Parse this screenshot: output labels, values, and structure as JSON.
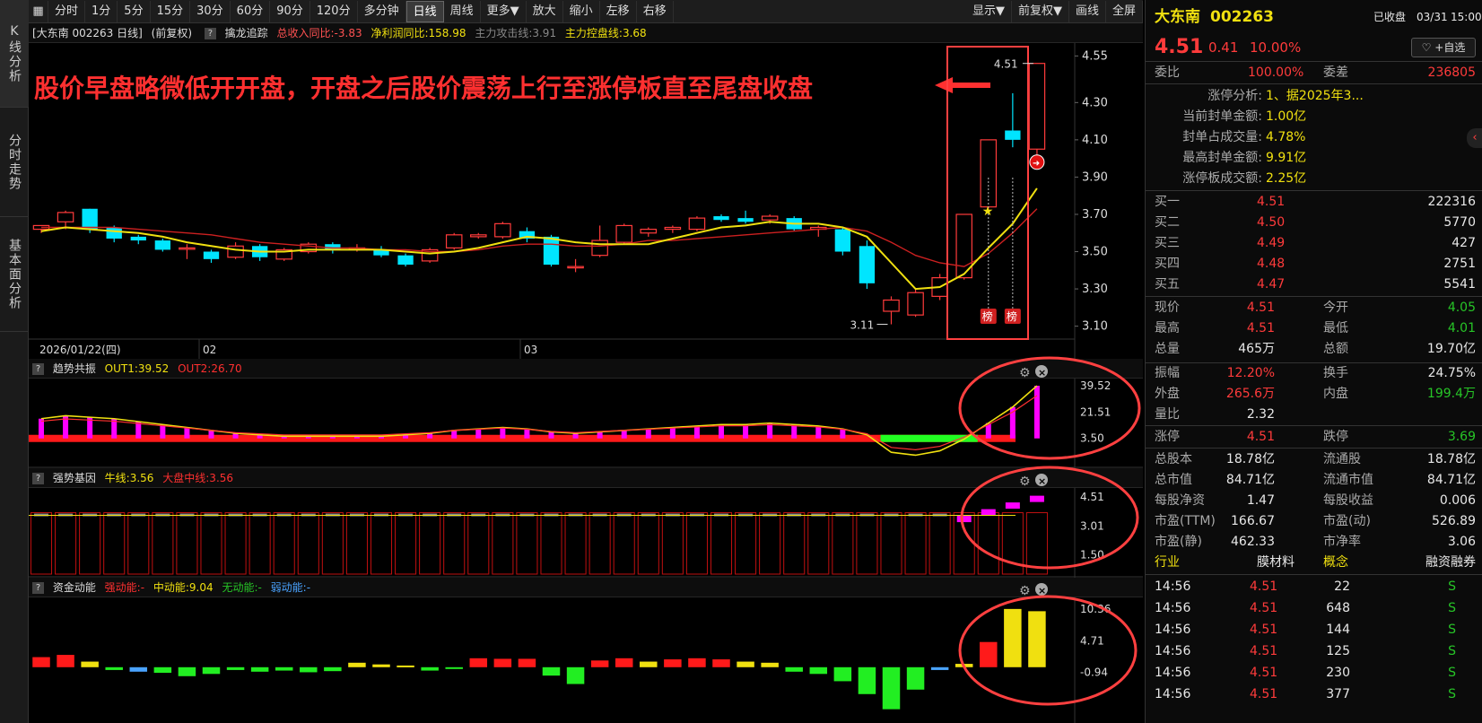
{
  "left_tabs": [
    "K线分析",
    "分时走势",
    "基本面分析"
  ],
  "toolbar": {
    "items": [
      "分时",
      "1分",
      "5分",
      "15分",
      "30分",
      "60分",
      "90分",
      "120分",
      "多分钟",
      "日线",
      "周线",
      "更多▼",
      "放大",
      "缩小",
      "左移",
      "右移"
    ],
    "active": "日线",
    "right_items": [
      "显示▼",
      "前复权▼",
      "画线",
      "全屏"
    ]
  },
  "main_header": {
    "stock": "[大东南 002263 日线]",
    "adj": "(前复权)",
    "indicator": "擒龙追踪",
    "rev_yoy": "总收入同比:-3.83",
    "profit_yoy": "净利润同比:158.98",
    "attack_line": "主力攻击线:3.91",
    "control_line": "主力控盘线:3.68"
  },
  "annotation": "股价早盘略微低开开盘，开盘之后股价震荡上行至涨停板直至尾盘收盘",
  "price_axis": [
    "4.55",
    "4.30",
    "4.10",
    "3.90",
    "3.70",
    "3.50",
    "3.30",
    "3.10"
  ],
  "price_labels": {
    "high": "4.51",
    "low": "3.11"
  },
  "bang_label": "榜",
  "date_axis": {
    "start": "2026/01/22(四)",
    "m2": "02",
    "m3": "03"
  },
  "panel1": {
    "name": "趋势共振",
    "out1": "OUT1:39.52",
    "out2": "OUT2:26.70",
    "axis": [
      "39.52",
      "21.51",
      "3.50"
    ]
  },
  "panel2": {
    "name": "强势基因",
    "bull": "牛线:3.56",
    "mid": "大盘中线:3.56",
    "axis": [
      "4.51",
      "3.01",
      "1.50"
    ]
  },
  "panel3": {
    "name": "资金动能",
    "strong": "强动能:-",
    "medium": "中动能:9.04",
    "none": "无动能:-",
    "weak": "弱动能:-",
    "axis": [
      "10.36",
      "4.71",
      "-0.94"
    ]
  },
  "right": {
    "name": "大东南",
    "code": "002263",
    "status": "已收盘",
    "date": "03/31",
    "time": "15:00",
    "price": "4.51",
    "change": "0.41",
    "pct": "10.00%",
    "watch": "+自选",
    "wei_bi_label": "委比",
    "wei_bi": "100.00%",
    "wei_cha_label": "委差",
    "wei_cha": "236805",
    "limit_analysis": [
      {
        "label": "涨停分析:",
        "value": "1、据2025年3..."
      },
      {
        "label": "当前封单金额:",
        "value": "1.00亿"
      },
      {
        "label": "封单占成交量:",
        "value": "4.78%"
      },
      {
        "label": "最高封单金额:",
        "value": "9.91亿"
      },
      {
        "label": "涨停板成交额:",
        "value": "2.25亿"
      }
    ],
    "bids": [
      {
        "label": "买一",
        "price": "4.51",
        "vol": "222316"
      },
      {
        "label": "买二",
        "price": "4.50",
        "vol": "5770"
      },
      {
        "label": "买三",
        "price": "4.49",
        "vol": "427"
      },
      {
        "label": "买四",
        "price": "4.48",
        "vol": "2751"
      },
      {
        "label": "买五",
        "price": "4.47",
        "vol": "5541"
      }
    ],
    "stats": [
      {
        "l1": "现价",
        "v1": "4.51",
        "c1": "red",
        "l2": "今开",
        "v2": "4.05",
        "c2": "green"
      },
      {
        "l1": "最高",
        "v1": "4.51",
        "c1": "red",
        "l2": "最低",
        "v2": "4.01",
        "c2": "green"
      },
      {
        "l1": "总量",
        "v1": "465万",
        "c1": "white",
        "l2": "总额",
        "v2": "19.70亿",
        "c2": "white"
      }
    ],
    "stats2": [
      {
        "l1": "振幅",
        "v1": "12.20%",
        "c1": "red",
        "l2": "换手",
        "v2": "24.75%",
        "c2": "white"
      },
      {
        "l1": "外盘",
        "v1": "265.6万",
        "c1": "red",
        "l2": "内盘",
        "v2": "199.4万",
        "c2": "green"
      },
      {
        "l1": "量比",
        "v1": "2.32",
        "c1": "white",
        "l2": "",
        "v2": "",
        "c2": "white"
      }
    ],
    "limits": {
      "l1": "涨停",
      "v1": "4.51",
      "l2": "跌停",
      "v2": "3.69"
    },
    "fund": [
      {
        "l1": "总股本",
        "v1": "18.78亿",
        "l2": "流通股",
        "v2": "18.78亿"
      },
      {
        "l1": "总市值",
        "v1": "84.71亿",
        "l2": "流通市值",
        "v2": "84.71亿"
      },
      {
        "l1": "每股净资",
        "v1": "1.47",
        "l2": "每股收益",
        "v2": "0.006"
      },
      {
        "l1": "市盈(TTM)",
        "v1": "166.67",
        "l2": "市盈(动)",
        "v2": "526.89"
      },
      {
        "l1": "市盈(静)",
        "v1": "462.33",
        "l2": "市净率",
        "v2": "3.06"
      }
    ],
    "industry": {
      "l1": "行业",
      "v1": "膜材料",
      "l2": "概念",
      "v2": "融资融券"
    },
    "ticks": [
      {
        "time": "14:56",
        "price": "4.51",
        "vol": "22",
        "side": "S"
      },
      {
        "time": "14:56",
        "price": "4.51",
        "vol": "648",
        "side": "S"
      },
      {
        "time": "14:56",
        "price": "4.51",
        "vol": "144",
        "side": "S"
      },
      {
        "time": "14:56",
        "price": "4.51",
        "vol": "125",
        "side": "S"
      },
      {
        "time": "14:56",
        "price": "4.51",
        "vol": "230",
        "side": "S"
      },
      {
        "time": "14:56",
        "price": "4.51",
        "vol": "377",
        "side": "S"
      }
    ]
  },
  "colors": {
    "up": "#ff3b3b",
    "down": "#00e5ff",
    "ma5": "#f0e010",
    "ma10": "#cc2020",
    "annotation": "#ff3030",
    "magenta": "#ff00ff"
  },
  "candles": [
    [
      3.62,
      3.64,
      3.6,
      3.64
    ],
    [
      3.66,
      3.72,
      3.62,
      3.71
    ],
    [
      3.73,
      3.73,
      3.6,
      3.62
    ],
    [
      3.63,
      3.64,
      3.55,
      3.57
    ],
    [
      3.58,
      3.59,
      3.54,
      3.56
    ],
    [
      3.56,
      3.57,
      3.5,
      3.51
    ],
    [
      3.52,
      3.54,
      3.46,
      3.52
    ],
    [
      3.5,
      3.51,
      3.44,
      3.46
    ],
    [
      3.47,
      3.55,
      3.46,
      3.53
    ],
    [
      3.53,
      3.54,
      3.45,
      3.47
    ],
    [
      3.46,
      3.52,
      3.45,
      3.51
    ],
    [
      3.5,
      3.55,
      3.49,
      3.54
    ],
    [
      3.54,
      3.55,
      3.49,
      3.51
    ],
    [
      3.52,
      3.54,
      3.5,
      3.52
    ],
    [
      3.51,
      3.53,
      3.47,
      3.48
    ],
    [
      3.48,
      3.49,
      3.42,
      3.43
    ],
    [
      3.45,
      3.52,
      3.44,
      3.51
    ],
    [
      3.52,
      3.6,
      3.51,
      3.59
    ],
    [
      3.58,
      3.6,
      3.57,
      3.59
    ],
    [
      3.58,
      3.66,
      3.57,
      3.65
    ],
    [
      3.61,
      3.63,
      3.55,
      3.57
    ],
    [
      3.58,
      3.59,
      3.42,
      3.43
    ],
    [
      3.42,
      3.46,
      3.39,
      3.42
    ],
    [
      3.48,
      3.64,
      3.47,
      3.56
    ],
    [
      3.55,
      3.65,
      3.54,
      3.64
    ],
    [
      3.6,
      3.63,
      3.58,
      3.62
    ],
    [
      3.62,
      3.64,
      3.6,
      3.63
    ],
    [
      3.62,
      3.69,
      3.61,
      3.68
    ],
    [
      3.69,
      3.7,
      3.66,
      3.67
    ],
    [
      3.68,
      3.72,
      3.65,
      3.66
    ],
    [
      3.67,
      3.7,
      3.65,
      3.69
    ],
    [
      3.68,
      3.69,
      3.61,
      3.62
    ],
    [
      3.62,
      3.64,
      3.58,
      3.63
    ],
    [
      3.62,
      3.63,
      3.48,
      3.5
    ],
    [
      3.53,
      3.56,
      3.3,
      3.33
    ],
    [
      3.18,
      3.26,
      3.11,
      3.24
    ],
    [
      3.16,
      3.3,
      3.15,
      3.28
    ],
    [
      3.26,
      3.38,
      3.24,
      3.36
    ],
    [
      3.36,
      3.7,
      3.35,
      3.7
    ],
    [
      3.74,
      4.1,
      3.73,
      4.1
    ],
    [
      4.15,
      4.35,
      4.06,
      4.1
    ],
    [
      4.05,
      4.51,
      4.01,
      4.51
    ]
  ],
  "ma5": [
    3.61,
    3.63,
    3.62,
    3.61,
    3.6,
    3.58,
    3.55,
    3.53,
    3.51,
    3.5,
    3.5,
    3.51,
    3.51,
    3.51,
    3.51,
    3.5,
    3.49,
    3.5,
    3.52,
    3.55,
    3.58,
    3.57,
    3.55,
    3.54,
    3.54,
    3.54,
    3.57,
    3.6,
    3.63,
    3.64,
    3.66,
    3.65,
    3.65,
    3.63,
    3.58,
    3.44,
    3.3,
    3.31,
    3.38,
    3.52,
    3.65,
    3.84
  ],
  "ma10": [
    3.63,
    3.63,
    3.63,
    3.63,
    3.62,
    3.61,
    3.6,
    3.59,
    3.57,
    3.55,
    3.54,
    3.53,
    3.52,
    3.52,
    3.51,
    3.51,
    3.5,
    3.5,
    3.51,
    3.53,
    3.54,
    3.54,
    3.53,
    3.53,
    3.54,
    3.56,
    3.56,
    3.57,
    3.58,
    3.59,
    3.6,
    3.61,
    3.62,
    3.63,
    3.61,
    3.55,
    3.48,
    3.44,
    3.42,
    3.49,
    3.6,
    3.73
  ],
  "ind1": [
    17,
    19,
    18,
    17,
    15,
    13,
    11,
    9,
    7,
    6,
    5,
    5,
    5,
    5,
    5,
    6,
    7,
    9,
    10,
    11,
    10,
    8,
    7,
    8,
    9,
    10,
    11,
    12,
    13,
    13,
    14,
    13,
    12,
    10,
    6,
    -6,
    -8,
    -5,
    3,
    14,
    25,
    39.5
  ],
  "ind2_bars": [
    [
      0,
      0.95
    ],
    [
      1,
      0.95
    ],
    [
      2,
      0.95
    ],
    [
      3,
      0.95
    ],
    [
      4,
      0.95
    ],
    [
      5,
      0.95
    ],
    [
      6,
      0.95
    ],
    [
      7,
      0.95
    ],
    [
      8,
      0.95
    ],
    [
      9,
      0.95
    ],
    [
      10,
      0.95
    ],
    [
      11,
      0.95
    ],
    [
      12,
      0.95
    ],
    [
      13,
      0.95
    ],
    [
      14,
      0.95
    ],
    [
      15,
      0.95
    ],
    [
      16,
      0.95
    ],
    [
      17,
      0.95
    ],
    [
      18,
      0.95
    ],
    [
      19,
      0.95
    ],
    [
      20,
      0.95
    ],
    [
      21,
      0.95
    ],
    [
      22,
      0.95
    ],
    [
      23,
      0.95
    ],
    [
      24,
      0.95
    ],
    [
      25,
      0.95
    ],
    [
      26,
      0.95
    ],
    [
      27,
      0.95
    ],
    [
      28,
      0.95
    ],
    [
      29,
      0.95
    ],
    [
      30,
      0.95
    ],
    [
      31,
      0.95
    ],
    [
      32,
      0.95
    ],
    [
      33,
      0.95
    ],
    [
      34,
      0.95
    ],
    [
      35,
      0.95
    ],
    [
      36,
      0.95
    ],
    [
      37,
      0.95
    ],
    [
      38,
      0.95
    ],
    [
      39,
      0.95
    ],
    [
      40,
      0.95
    ],
    [
      41,
      0.95
    ]
  ],
  "ind3": [
    1.8,
    2.2,
    1.0,
    -0.5,
    -0.8,
    -1.0,
    -1.6,
    -1.2,
    -0.5,
    -0.8,
    -0.6,
    -0.9,
    -0.7,
    0.8,
    0.5,
    0.3,
    -0.6,
    -0.3,
    1.6,
    1.5,
    1.5,
    -1.5,
    -3.0,
    1.2,
    1.6,
    1.0,
    1.4,
    1.6,
    1.4,
    1.0,
    0.8,
    -0.8,
    -1.2,
    -2.5,
    -4.8,
    -7.5,
    -4.0,
    -0.5,
    0.6,
    4.5,
    10.4,
    10.0
  ]
}
